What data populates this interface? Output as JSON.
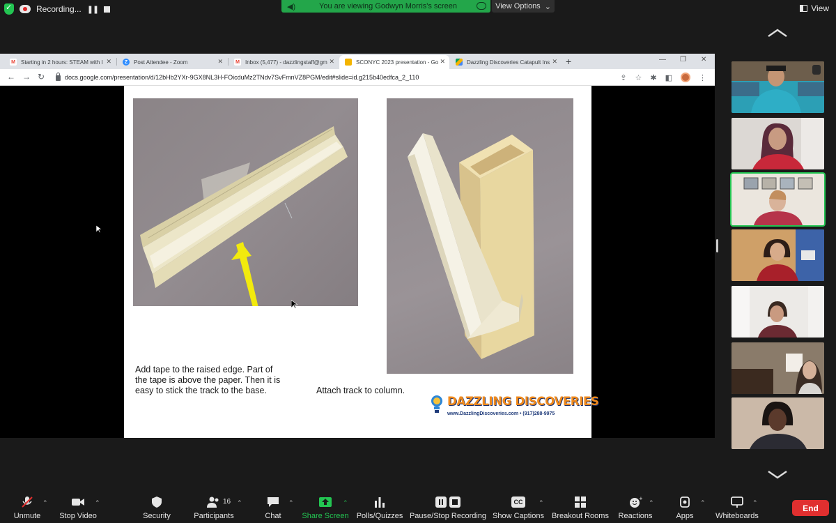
{
  "top": {
    "recording_label": "Recording...",
    "viewing_label": "You are viewing Godwyn Morris's screen",
    "view_options_label": "View Options",
    "view_label": "View"
  },
  "browser": {
    "tabs": [
      {
        "label": "Starting in 2 hours: STEAM with I",
        "favicon": "gmail-icon",
        "color": "#ea4335"
      },
      {
        "label": "Post Attendee - Zoom",
        "favicon": "zoom-icon",
        "color": "#2d8cff"
      },
      {
        "label": "Inbox (5,477) - dazzlingstaff@gm",
        "favicon": "gmail-icon",
        "color": "#ea4335"
      },
      {
        "label": "SCONYC 2023 presentation - Go",
        "favicon": "slides-icon",
        "color": "#f4b400"
      },
      {
        "label": "Dazzling Discoveries Catapult Ins",
        "favicon": "drive-icon",
        "color": "#0f9d58"
      }
    ],
    "url": "docs.google.com/presentation/d/12bHb2YXr-9GX8NL3H-FOicduMz2TNdv7SvFmnVZ8PGM/edit#slide=id.g215b40edfca_2_110"
  },
  "slide": {
    "caption_left": "Add tape to the raised edge. Part of the tape is above the paper. Then it is easy to stick the track to the base.",
    "caption_right": "Attach track to column.",
    "logo_name": "DAZZLING DISCOVERIES",
    "logo_sub": "www.DazzlingDiscoveries.com  •  (917)288-9975"
  },
  "toolbar": {
    "unmute": "Unmute",
    "stop_video": "Stop Video",
    "security": "Security",
    "participants": "Participants",
    "participants_count": "16",
    "chat": "Chat",
    "share_screen": "Share Screen",
    "polls": "Polls/Quizzes",
    "pause_stop": "Pause/Stop Recording",
    "captions": "Show Captions",
    "breakout": "Breakout Rooms",
    "reactions": "Reactions",
    "apps": "Apps",
    "whiteboards": "Whiteboards",
    "end": "End",
    "cc_text": "CC"
  },
  "colors": {
    "accent_green": "#23c552",
    "end_red": "#e02f2f",
    "logo_orange": "#f08a1c",
    "logo_blue": "#1f3b7a"
  }
}
